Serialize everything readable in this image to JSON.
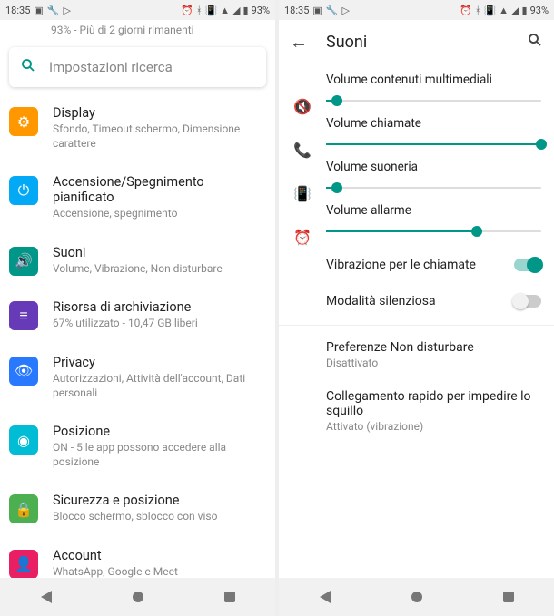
{
  "status": {
    "time": "18:35",
    "battery": "93%"
  },
  "left": {
    "partial_sub": "93% - Più di 2 giorni rimanenti",
    "search_placeholder": "Impostazioni ricerca",
    "items": [
      {
        "title": "Display",
        "sub": "Sfondo, Timeout schermo, Dimensione carattere",
        "color": "#FF9800",
        "icon": "⚙"
      },
      {
        "title": "Accensione/Spegnimento pianificato",
        "sub": "Accensione, spegnimento",
        "color": "#03A9F4",
        "icon": "⏻"
      },
      {
        "title": "Suoni",
        "sub": "Volume, Vibrazione, Non disturbare",
        "color": "#009688",
        "icon": "🔊"
      },
      {
        "title": "Risorsa di archiviazione",
        "sub": "67% utilizzato - 10,47 GB liberi",
        "color": "#673AB7",
        "icon": "≡"
      },
      {
        "title": "Privacy",
        "sub": "Autorizzazioni, Attività dell'account, Dati personali",
        "color": "#2979FF",
        "icon": "👁"
      },
      {
        "title": "Posizione",
        "sub": "ON - 5 le app possono accedere alla posizione",
        "color": "#00BCD4",
        "icon": "📍"
      },
      {
        "title": "Sicurezza e posizione",
        "sub": "Blocco schermo, sblocco con viso",
        "color": "#4CAF50",
        "icon": "🔒"
      },
      {
        "title": "Account",
        "sub": "WhatsApp, Google e Meet",
        "color": "#E91E63",
        "icon": "👤"
      }
    ]
  },
  "right": {
    "title": "Suoni",
    "sliders": {
      "media": {
        "label": "Volume contenuti multimediali",
        "value": 5
      },
      "calls": {
        "label": "Volume chiamate",
        "value": 100
      },
      "ring": {
        "label": "Volume suoneria",
        "value": 5
      },
      "alarm": {
        "label": "Volume allarme",
        "value": 70
      }
    },
    "switches": {
      "vibrate_calls": {
        "label": "Vibrazione per le chiamate",
        "on": true
      },
      "silent": {
        "label": "Modalità silenziosa",
        "on": false
      }
    },
    "prefs": {
      "dnd": {
        "title": "Preferenze Non disturbare",
        "sub": "Disattivato"
      },
      "shortcut": {
        "title": "Collegamento rapido per impedire lo squillo",
        "sub": "Attivato (vibrazione)"
      }
    }
  }
}
